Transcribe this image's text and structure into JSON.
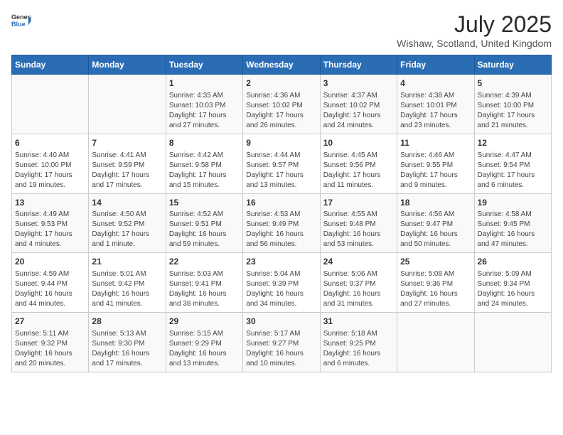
{
  "header": {
    "logo_general": "General",
    "logo_blue": "Blue",
    "title": "July 2025",
    "subtitle": "Wishaw, Scotland, United Kingdom"
  },
  "days_of_week": [
    "Sunday",
    "Monday",
    "Tuesday",
    "Wednesday",
    "Thursday",
    "Friday",
    "Saturday"
  ],
  "weeks": [
    [
      {
        "day": "",
        "detail": ""
      },
      {
        "day": "",
        "detail": ""
      },
      {
        "day": "1",
        "detail": "Sunrise: 4:35 AM\nSunset: 10:03 PM\nDaylight: 17 hours and 27 minutes."
      },
      {
        "day": "2",
        "detail": "Sunrise: 4:36 AM\nSunset: 10:02 PM\nDaylight: 17 hours and 26 minutes."
      },
      {
        "day": "3",
        "detail": "Sunrise: 4:37 AM\nSunset: 10:02 PM\nDaylight: 17 hours and 24 minutes."
      },
      {
        "day": "4",
        "detail": "Sunrise: 4:38 AM\nSunset: 10:01 PM\nDaylight: 17 hours and 23 minutes."
      },
      {
        "day": "5",
        "detail": "Sunrise: 4:39 AM\nSunset: 10:00 PM\nDaylight: 17 hours and 21 minutes."
      }
    ],
    [
      {
        "day": "6",
        "detail": "Sunrise: 4:40 AM\nSunset: 10:00 PM\nDaylight: 17 hours and 19 minutes."
      },
      {
        "day": "7",
        "detail": "Sunrise: 4:41 AM\nSunset: 9:59 PM\nDaylight: 17 hours and 17 minutes."
      },
      {
        "day": "8",
        "detail": "Sunrise: 4:42 AM\nSunset: 9:58 PM\nDaylight: 17 hours and 15 minutes."
      },
      {
        "day": "9",
        "detail": "Sunrise: 4:44 AM\nSunset: 9:57 PM\nDaylight: 17 hours and 13 minutes."
      },
      {
        "day": "10",
        "detail": "Sunrise: 4:45 AM\nSunset: 9:56 PM\nDaylight: 17 hours and 11 minutes."
      },
      {
        "day": "11",
        "detail": "Sunrise: 4:46 AM\nSunset: 9:55 PM\nDaylight: 17 hours and 9 minutes."
      },
      {
        "day": "12",
        "detail": "Sunrise: 4:47 AM\nSunset: 9:54 PM\nDaylight: 17 hours and 6 minutes."
      }
    ],
    [
      {
        "day": "13",
        "detail": "Sunrise: 4:49 AM\nSunset: 9:53 PM\nDaylight: 17 hours and 4 minutes."
      },
      {
        "day": "14",
        "detail": "Sunrise: 4:50 AM\nSunset: 9:52 PM\nDaylight: 17 hours and 1 minute."
      },
      {
        "day": "15",
        "detail": "Sunrise: 4:52 AM\nSunset: 9:51 PM\nDaylight: 16 hours and 59 minutes."
      },
      {
        "day": "16",
        "detail": "Sunrise: 4:53 AM\nSunset: 9:49 PM\nDaylight: 16 hours and 56 minutes."
      },
      {
        "day": "17",
        "detail": "Sunrise: 4:55 AM\nSunset: 9:48 PM\nDaylight: 16 hours and 53 minutes."
      },
      {
        "day": "18",
        "detail": "Sunrise: 4:56 AM\nSunset: 9:47 PM\nDaylight: 16 hours and 50 minutes."
      },
      {
        "day": "19",
        "detail": "Sunrise: 4:58 AM\nSunset: 9:45 PM\nDaylight: 16 hours and 47 minutes."
      }
    ],
    [
      {
        "day": "20",
        "detail": "Sunrise: 4:59 AM\nSunset: 9:44 PM\nDaylight: 16 hours and 44 minutes."
      },
      {
        "day": "21",
        "detail": "Sunrise: 5:01 AM\nSunset: 9:42 PM\nDaylight: 16 hours and 41 minutes."
      },
      {
        "day": "22",
        "detail": "Sunrise: 5:03 AM\nSunset: 9:41 PM\nDaylight: 16 hours and 38 minutes."
      },
      {
        "day": "23",
        "detail": "Sunrise: 5:04 AM\nSunset: 9:39 PM\nDaylight: 16 hours and 34 minutes."
      },
      {
        "day": "24",
        "detail": "Sunrise: 5:06 AM\nSunset: 9:37 PM\nDaylight: 16 hours and 31 minutes."
      },
      {
        "day": "25",
        "detail": "Sunrise: 5:08 AM\nSunset: 9:36 PM\nDaylight: 16 hours and 27 minutes."
      },
      {
        "day": "26",
        "detail": "Sunrise: 5:09 AM\nSunset: 9:34 PM\nDaylight: 16 hours and 24 minutes."
      }
    ],
    [
      {
        "day": "27",
        "detail": "Sunrise: 5:11 AM\nSunset: 9:32 PM\nDaylight: 16 hours and 20 minutes."
      },
      {
        "day": "28",
        "detail": "Sunrise: 5:13 AM\nSunset: 9:30 PM\nDaylight: 16 hours and 17 minutes."
      },
      {
        "day": "29",
        "detail": "Sunrise: 5:15 AM\nSunset: 9:29 PM\nDaylight: 16 hours and 13 minutes."
      },
      {
        "day": "30",
        "detail": "Sunrise: 5:17 AM\nSunset: 9:27 PM\nDaylight: 16 hours and 10 minutes."
      },
      {
        "day": "31",
        "detail": "Sunrise: 5:18 AM\nSunset: 9:25 PM\nDaylight: 16 hours and 6 minutes."
      },
      {
        "day": "",
        "detail": ""
      },
      {
        "day": "",
        "detail": ""
      }
    ]
  ]
}
